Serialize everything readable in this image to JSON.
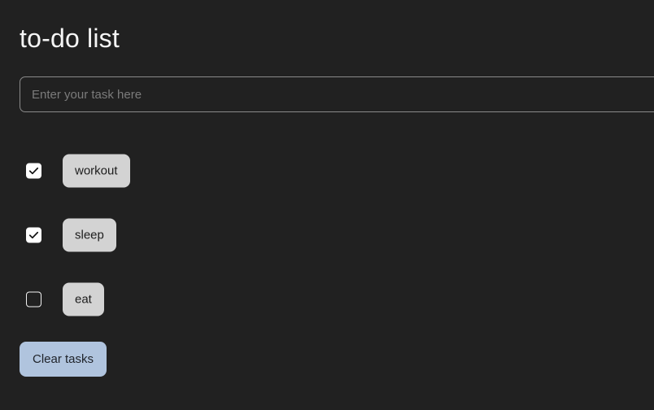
{
  "app": {
    "title": "to-do list",
    "background_color": "#212121"
  },
  "input": {
    "name": "task-entry",
    "value": "",
    "placeholder": "Enter your task here"
  },
  "tasks": [
    {
      "label": "workout",
      "checked": true,
      "checkbox_icon": "checkmark-icon"
    },
    {
      "label": "sleep",
      "checked": true,
      "checkbox_icon": "checkmark-icon"
    },
    {
      "label": "eat",
      "checked": false,
      "checkbox_icon": "empty-checkbox-icon"
    }
  ],
  "actions": {
    "clear_label": "Clear tasks",
    "clear_color": "#b0c4de"
  },
  "colors": {
    "background": "#212121",
    "title_text": "#f5f5f5",
    "pill_background": "#d3d3d3",
    "pill_text": "#1c1c1c",
    "placeholder_text": "#7b7b7b",
    "input_border": "#8a8a8a",
    "checkbox_checked_fill": "#ffffff",
    "checkbox_border": "#f2f2f2",
    "clear_button": "#b0c4de"
  }
}
